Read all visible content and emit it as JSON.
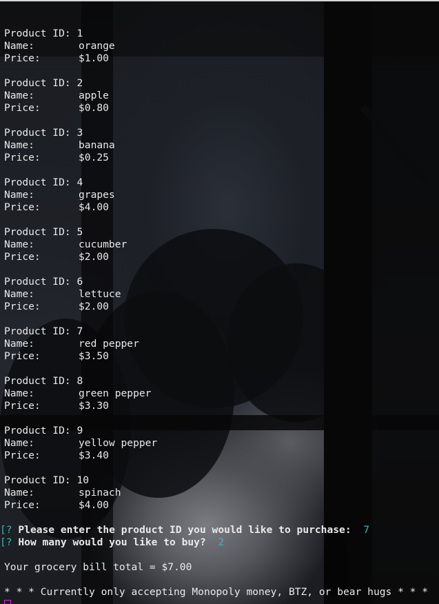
{
  "terminal": {
    "products": [
      {
        "id_label": "Product ID:",
        "id": "1",
        "name_label": "Name:",
        "name": "orange",
        "price_label": "Price:",
        "price": "$1.00"
      },
      {
        "id_label": "Product ID:",
        "id": "2",
        "name_label": "Name:",
        "name": "apple",
        "price_label": "Price:",
        "price": "$0.80"
      },
      {
        "id_label": "Product ID:",
        "id": "3",
        "name_label": "Name:",
        "name": "banana",
        "price_label": "Price:",
        "price": "$0.25"
      },
      {
        "id_label": "Product ID:",
        "id": "4",
        "name_label": "Name:",
        "name": "grapes",
        "price_label": "Price:",
        "price": "$4.00"
      },
      {
        "id_label": "Product ID:",
        "id": "5",
        "name_label": "Name:",
        "name": "cucumber",
        "price_label": "Price:",
        "price": "$2.00"
      },
      {
        "id_label": "Product ID:",
        "id": "6",
        "name_label": "Name:",
        "name": "lettuce",
        "price_label": "Price:",
        "price": "$2.00"
      },
      {
        "id_label": "Product ID:",
        "id": "7",
        "name_label": "Name:",
        "name": "red pepper",
        "price_label": "Price:",
        "price": "$3.50"
      },
      {
        "id_label": "Product ID:",
        "id": "8",
        "name_label": "Name:",
        "name": "green pepper",
        "price_label": "Price:",
        "price": "$3.30"
      },
      {
        "id_label": "Product ID:",
        "id": "9",
        "name_label": "Name:",
        "name": "yellow pepper",
        "price_label": "Price:",
        "price": "$3.40"
      },
      {
        "id_label": "Product ID:",
        "id": "10",
        "name_label": "Name:",
        "name": "spinach",
        "price_label": "Price:",
        "price": "$4.00"
      }
    ],
    "prompts": [
      {
        "marker": "[?",
        "question": "Please enter the product ID you would like to purchase:",
        "answer": "7"
      },
      {
        "marker": "[?",
        "question": "How many would you like to buy?",
        "answer": "2"
      }
    ],
    "total_line": "Your grocery bill total = $7.00",
    "notice_line": "* * * Currently only accepting Monopoly money, BTZ, or bear hugs * * *"
  },
  "colors": {
    "text": "#e9e9e9",
    "prompt_accent": "#3ab3b8",
    "cursor": "#d62bd6"
  }
}
